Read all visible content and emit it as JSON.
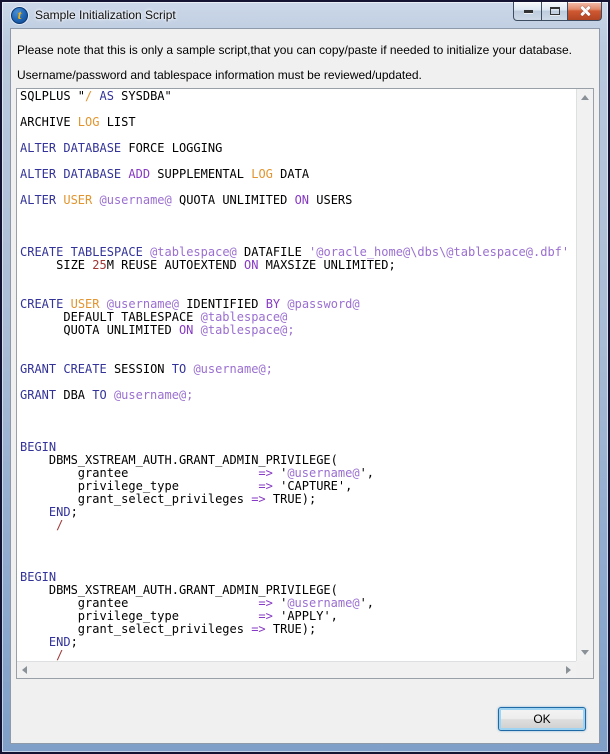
{
  "window": {
    "title": "Sample Initialization Script",
    "app_icon_letter": "t"
  },
  "icons": {
    "app": "talend-circle-t",
    "minimize": "minimize-bar",
    "maximize": "maximize-square",
    "close": "close-x",
    "scroll_up": "triangle-up",
    "scroll_down": "triangle-down",
    "scroll_left": "triangle-left",
    "scroll_right": "triangle-right"
  },
  "intro": {
    "line1": "Please note that this is only a sample script,that you can copy/paste if needed to initialize your database.",
    "line2": "Username/password and tablespace information must be reviewed/updated."
  },
  "ok_button": {
    "label": "OK"
  },
  "colors": {
    "k": "#333399",
    "p": "#8639C4",
    "o": "#E2952F",
    "v": "#9A6FD0",
    "n": "#A03535",
    "d": "#000000"
  },
  "script": {
    "lines": [
      [
        [
          "SQLPLUS \"",
          "d"
        ],
        [
          "/",
          "o"
        ],
        [
          " ",
          "d"
        ],
        [
          "AS",
          "k"
        ],
        [
          " SYSDBA\"",
          "d"
        ]
      ],
      [],
      [
        [
          "ARCHIVE ",
          "d"
        ],
        [
          "LOG",
          "o"
        ],
        [
          " LIST",
          "d"
        ]
      ],
      [],
      [
        [
          "ALTER",
          "k"
        ],
        [
          " ",
          "d"
        ],
        [
          "DATABASE",
          "k"
        ],
        [
          " FORCE LOGGING",
          "d"
        ]
      ],
      [],
      [
        [
          "ALTER",
          "k"
        ],
        [
          " ",
          "d"
        ],
        [
          "DATABASE",
          "k"
        ],
        [
          " ",
          "d"
        ],
        [
          "ADD",
          "p"
        ],
        [
          " SUPPLEMENTAL ",
          "d"
        ],
        [
          "LOG",
          "o"
        ],
        [
          " DATA",
          "d"
        ]
      ],
      [],
      [
        [
          "ALTER",
          "k"
        ],
        [
          " ",
          "d"
        ],
        [
          "USER",
          "o"
        ],
        [
          " ",
          "d"
        ],
        [
          "@username@",
          "v"
        ],
        [
          " QUOTA UNLIMITED ",
          "d"
        ],
        [
          "ON",
          "p"
        ],
        [
          " USERS",
          "d"
        ]
      ],
      [],
      [],
      [],
      [
        [
          "CREATE",
          "k"
        ],
        [
          " ",
          "d"
        ],
        [
          "TABLESPACE",
          "k"
        ],
        [
          " ",
          "d"
        ],
        [
          "@tablespace@",
          "v"
        ],
        [
          " DATAFILE ",
          "d"
        ],
        [
          "'@oracle_home@\\dbs\\@tablespace@.dbf'",
          "v"
        ]
      ],
      [
        [
          "     SIZE ",
          "d"
        ],
        [
          "25",
          "n"
        ],
        [
          "M REUSE AUTOEXTEND ",
          "d"
        ],
        [
          "ON",
          "p"
        ],
        [
          " MAXSIZE UNLIMITED;",
          "d"
        ]
      ],
      [],
      [],
      [
        [
          "CREATE",
          "k"
        ],
        [
          " ",
          "d"
        ],
        [
          "USER",
          "o"
        ],
        [
          " ",
          "d"
        ],
        [
          "@username@",
          "v"
        ],
        [
          " IDENTIFIED ",
          "d"
        ],
        [
          "BY",
          "p"
        ],
        [
          " ",
          "d"
        ],
        [
          "@password@",
          "v"
        ]
      ],
      [
        [
          "      DEFAULT TABLESPACE ",
          "d"
        ],
        [
          "@tablespace@",
          "v"
        ]
      ],
      [
        [
          "      QUOTA UNLIMITED ",
          "d"
        ],
        [
          "ON",
          "p"
        ],
        [
          " ",
          "d"
        ],
        [
          "@tablespace@;",
          "v"
        ]
      ],
      [],
      [],
      [
        [
          "GRANT",
          "k"
        ],
        [
          " ",
          "d"
        ],
        [
          "CREATE",
          "k"
        ],
        [
          " SESSION ",
          "d"
        ],
        [
          "TO",
          "k"
        ],
        [
          " ",
          "d"
        ],
        [
          "@username@;",
          "v"
        ]
      ],
      [],
      [
        [
          "GRANT",
          "k"
        ],
        [
          " DBA ",
          "d"
        ],
        [
          "TO",
          "k"
        ],
        [
          " ",
          "d"
        ],
        [
          "@username@;",
          "v"
        ]
      ],
      [],
      [],
      [],
      [
        [
          "BEGIN",
          "k"
        ]
      ],
      [
        [
          "    DBMS_XSTREAM_AUTH.GRANT_ADMIN_PRIVILEGE(",
          "d"
        ]
      ],
      [
        [
          "        grantee                  ",
          "d"
        ],
        [
          "=>",
          "p"
        ],
        [
          " '",
          "d"
        ],
        [
          "@username@",
          "v"
        ],
        [
          "',",
          "d"
        ]
      ],
      [
        [
          "        privilege_type           ",
          "d"
        ],
        [
          "=>",
          "p"
        ],
        [
          " 'CAPTURE',",
          "d"
        ]
      ],
      [
        [
          "        grant_select_privileges ",
          "d"
        ],
        [
          "=>",
          "p"
        ],
        [
          " TRUE);",
          "d"
        ]
      ],
      [
        [
          "    ",
          "d"
        ],
        [
          "END",
          "k"
        ],
        [
          ";",
          "d"
        ]
      ],
      [
        [
          "     ",
          "d"
        ],
        [
          "/",
          "n"
        ]
      ],
      [],
      [],
      [],
      [
        [
          "BEGIN",
          "k"
        ]
      ],
      [
        [
          "    DBMS_XSTREAM_AUTH.GRANT_ADMIN_PRIVILEGE(",
          "d"
        ]
      ],
      [
        [
          "        grantee                  ",
          "d"
        ],
        [
          "=>",
          "p"
        ],
        [
          " '",
          "d"
        ],
        [
          "@username@",
          "v"
        ],
        [
          "',",
          "d"
        ]
      ],
      [
        [
          "        privilege_type           ",
          "d"
        ],
        [
          "=>",
          "p"
        ],
        [
          " 'APPLY',",
          "d"
        ]
      ],
      [
        [
          "        grant_select_privileges ",
          "d"
        ],
        [
          "=>",
          "p"
        ],
        [
          " TRUE);",
          "d"
        ]
      ],
      [
        [
          "    ",
          "d"
        ],
        [
          "END",
          "k"
        ],
        [
          ";",
          "d"
        ]
      ],
      [
        [
          "     ",
          "d"
        ],
        [
          "/",
          "n"
        ]
      ]
    ]
  }
}
